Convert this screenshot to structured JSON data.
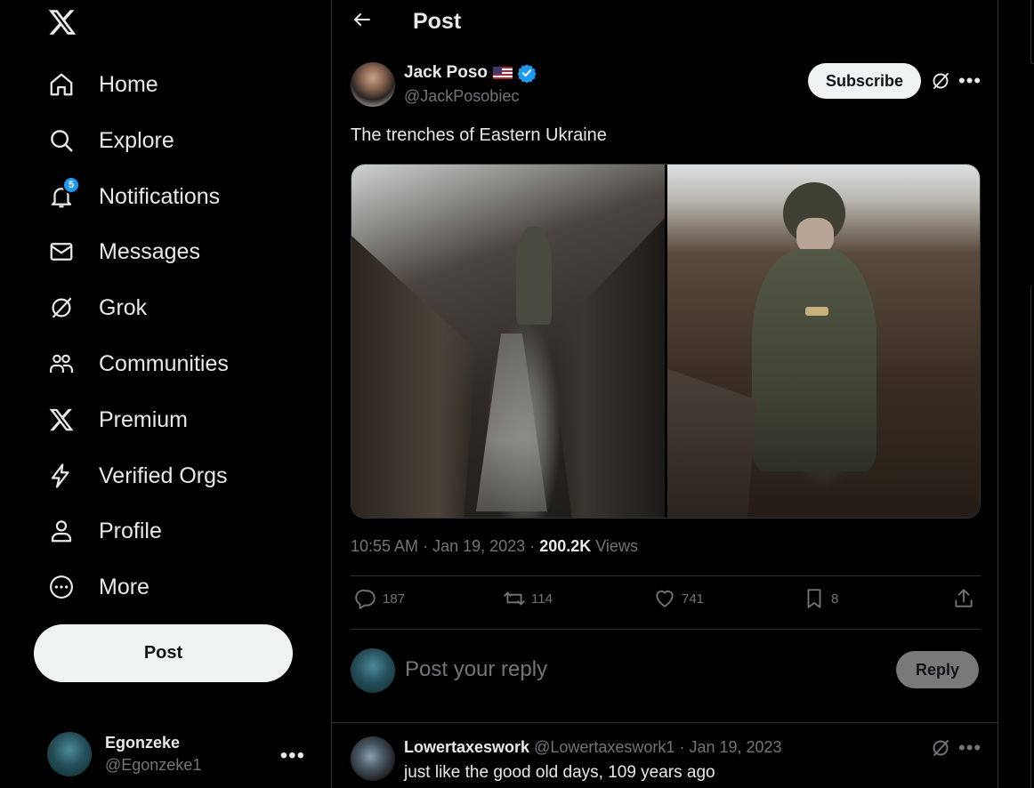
{
  "sidebar": {
    "logo_icon": "x-logo-icon",
    "nav": [
      {
        "label": "Home",
        "icon": "home-icon"
      },
      {
        "label": "Explore",
        "icon": "search-icon"
      },
      {
        "label": "Notifications",
        "icon": "bell-icon",
        "badge": "5"
      },
      {
        "label": "Messages",
        "icon": "envelope-icon"
      },
      {
        "label": "Grok",
        "icon": "grok-icon"
      },
      {
        "label": "Communities",
        "icon": "communities-icon"
      },
      {
        "label": "Premium",
        "icon": "x-logo-icon"
      },
      {
        "label": "Verified Orgs",
        "icon": "lightning-icon"
      },
      {
        "label": "Profile",
        "icon": "person-icon"
      },
      {
        "label": "More",
        "icon": "more-circle-icon"
      }
    ],
    "post_button": "Post",
    "account": {
      "name": "Egonzeke",
      "handle": "@Egonzeke1",
      "more": "•••"
    }
  },
  "header": {
    "title": "Post",
    "back_icon": "back-arrow-icon"
  },
  "tweet": {
    "author_name": "Jack Poso",
    "author_handle": "@JackPosobiec",
    "subscribe_label": "Subscribe",
    "more": "•••",
    "text": "The trenches of Eastern Ukraine",
    "time": "10:55 AM",
    "date": "Jan 19, 2023",
    "views_count": "200.2K",
    "views_label": "Views",
    "replies": "187",
    "reposts": "114",
    "likes": "741",
    "bookmarks": "8"
  },
  "reply_box": {
    "placeholder": "Post your reply",
    "button": "Reply"
  },
  "comment": {
    "name": "Lowertaxeswork",
    "handle": "@Lowertaxeswork1",
    "separator": "·",
    "date": "Jan 19, 2023",
    "text": "just like the good old days, 109 years ago",
    "more": "•••"
  },
  "colors": {
    "accent": "#1d9bf0",
    "background": "#000000",
    "text": "#e7e9ea",
    "muted": "#71767b",
    "border": "#2f3336"
  }
}
